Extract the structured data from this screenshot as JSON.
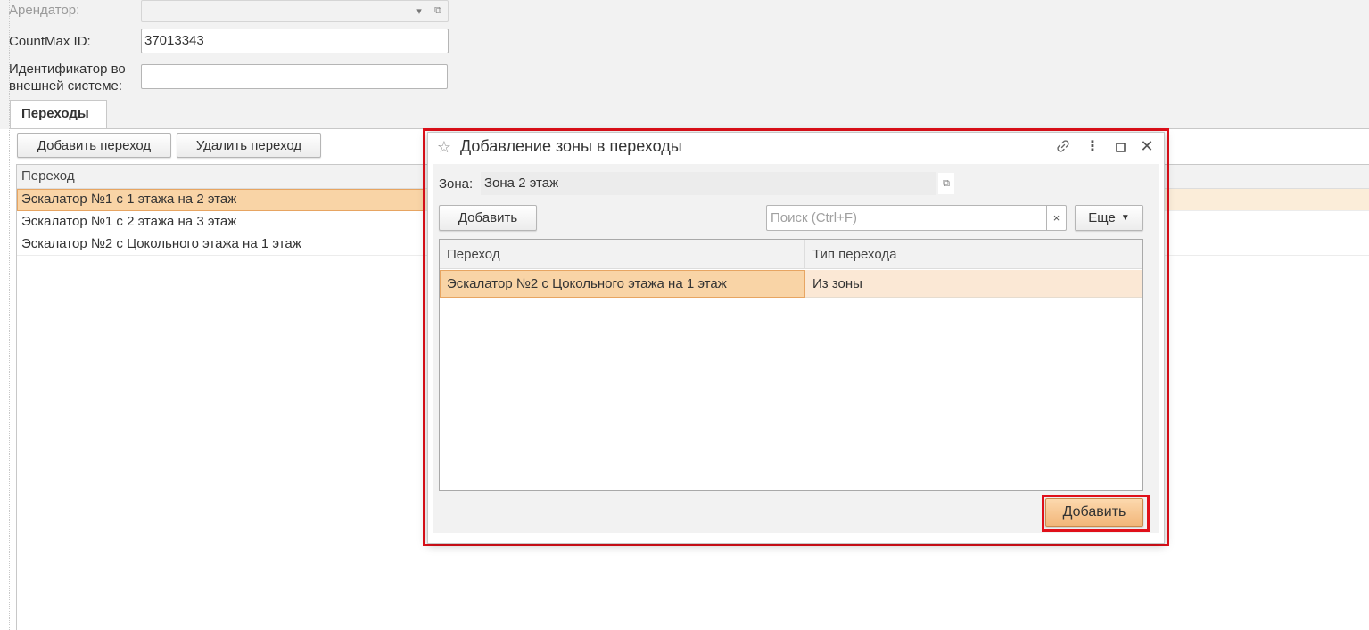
{
  "form": {
    "tenant_label": "Арендатор:",
    "tenant_value": "",
    "countmax_label": "CountMax ID:",
    "countmax_value": "37013343",
    "external_id_label_line1": "Идентификатор во",
    "external_id_label_line2": "внешней системе:",
    "external_id_value": ""
  },
  "tabs": [
    {
      "label": "Переходы",
      "active": true
    }
  ],
  "toolbar": {
    "add_transition": "Добавить переход",
    "delete_transition": "Удалить переход"
  },
  "transitions_table": {
    "header": "Переход",
    "rows": [
      {
        "name": "Эскалатор №1 с 1 этажа на 2 этаж",
        "selected": true
      },
      {
        "name": "Эскалатор №1 с 2 этажа на 3 этаж",
        "selected": false
      },
      {
        "name": "Эскалатор №2 с Цокольного этажа на 1 этаж",
        "selected": false
      }
    ]
  },
  "dialog": {
    "title": "Добавление зоны в переходы",
    "zone_label": "Зона:",
    "zone_value": "Зона 2 этаж",
    "add_button": "Добавить",
    "search_placeholder": "Поиск (Ctrl+F)",
    "search_clear": "×",
    "more_button": "Еще",
    "columns": [
      "Переход",
      "Тип перехода"
    ],
    "rows": [
      {
        "transition": "Эскалатор №2 с Цокольного этажа на 1 этаж",
        "type": "Из зоны",
        "selected": true
      }
    ],
    "confirm_button": "Добавить"
  },
  "colors": {
    "highlight_frame": "#e0101a",
    "selection": "#f9d4a6",
    "selected_row": "#fbe8d5",
    "primary_button": "#f2b679"
  },
  "icons": [
    "star-icon",
    "link-icon",
    "more-vertical-icon",
    "maximize-icon",
    "close-icon",
    "dropdown-arrow-icon",
    "open-icon",
    "clear-icon"
  ]
}
